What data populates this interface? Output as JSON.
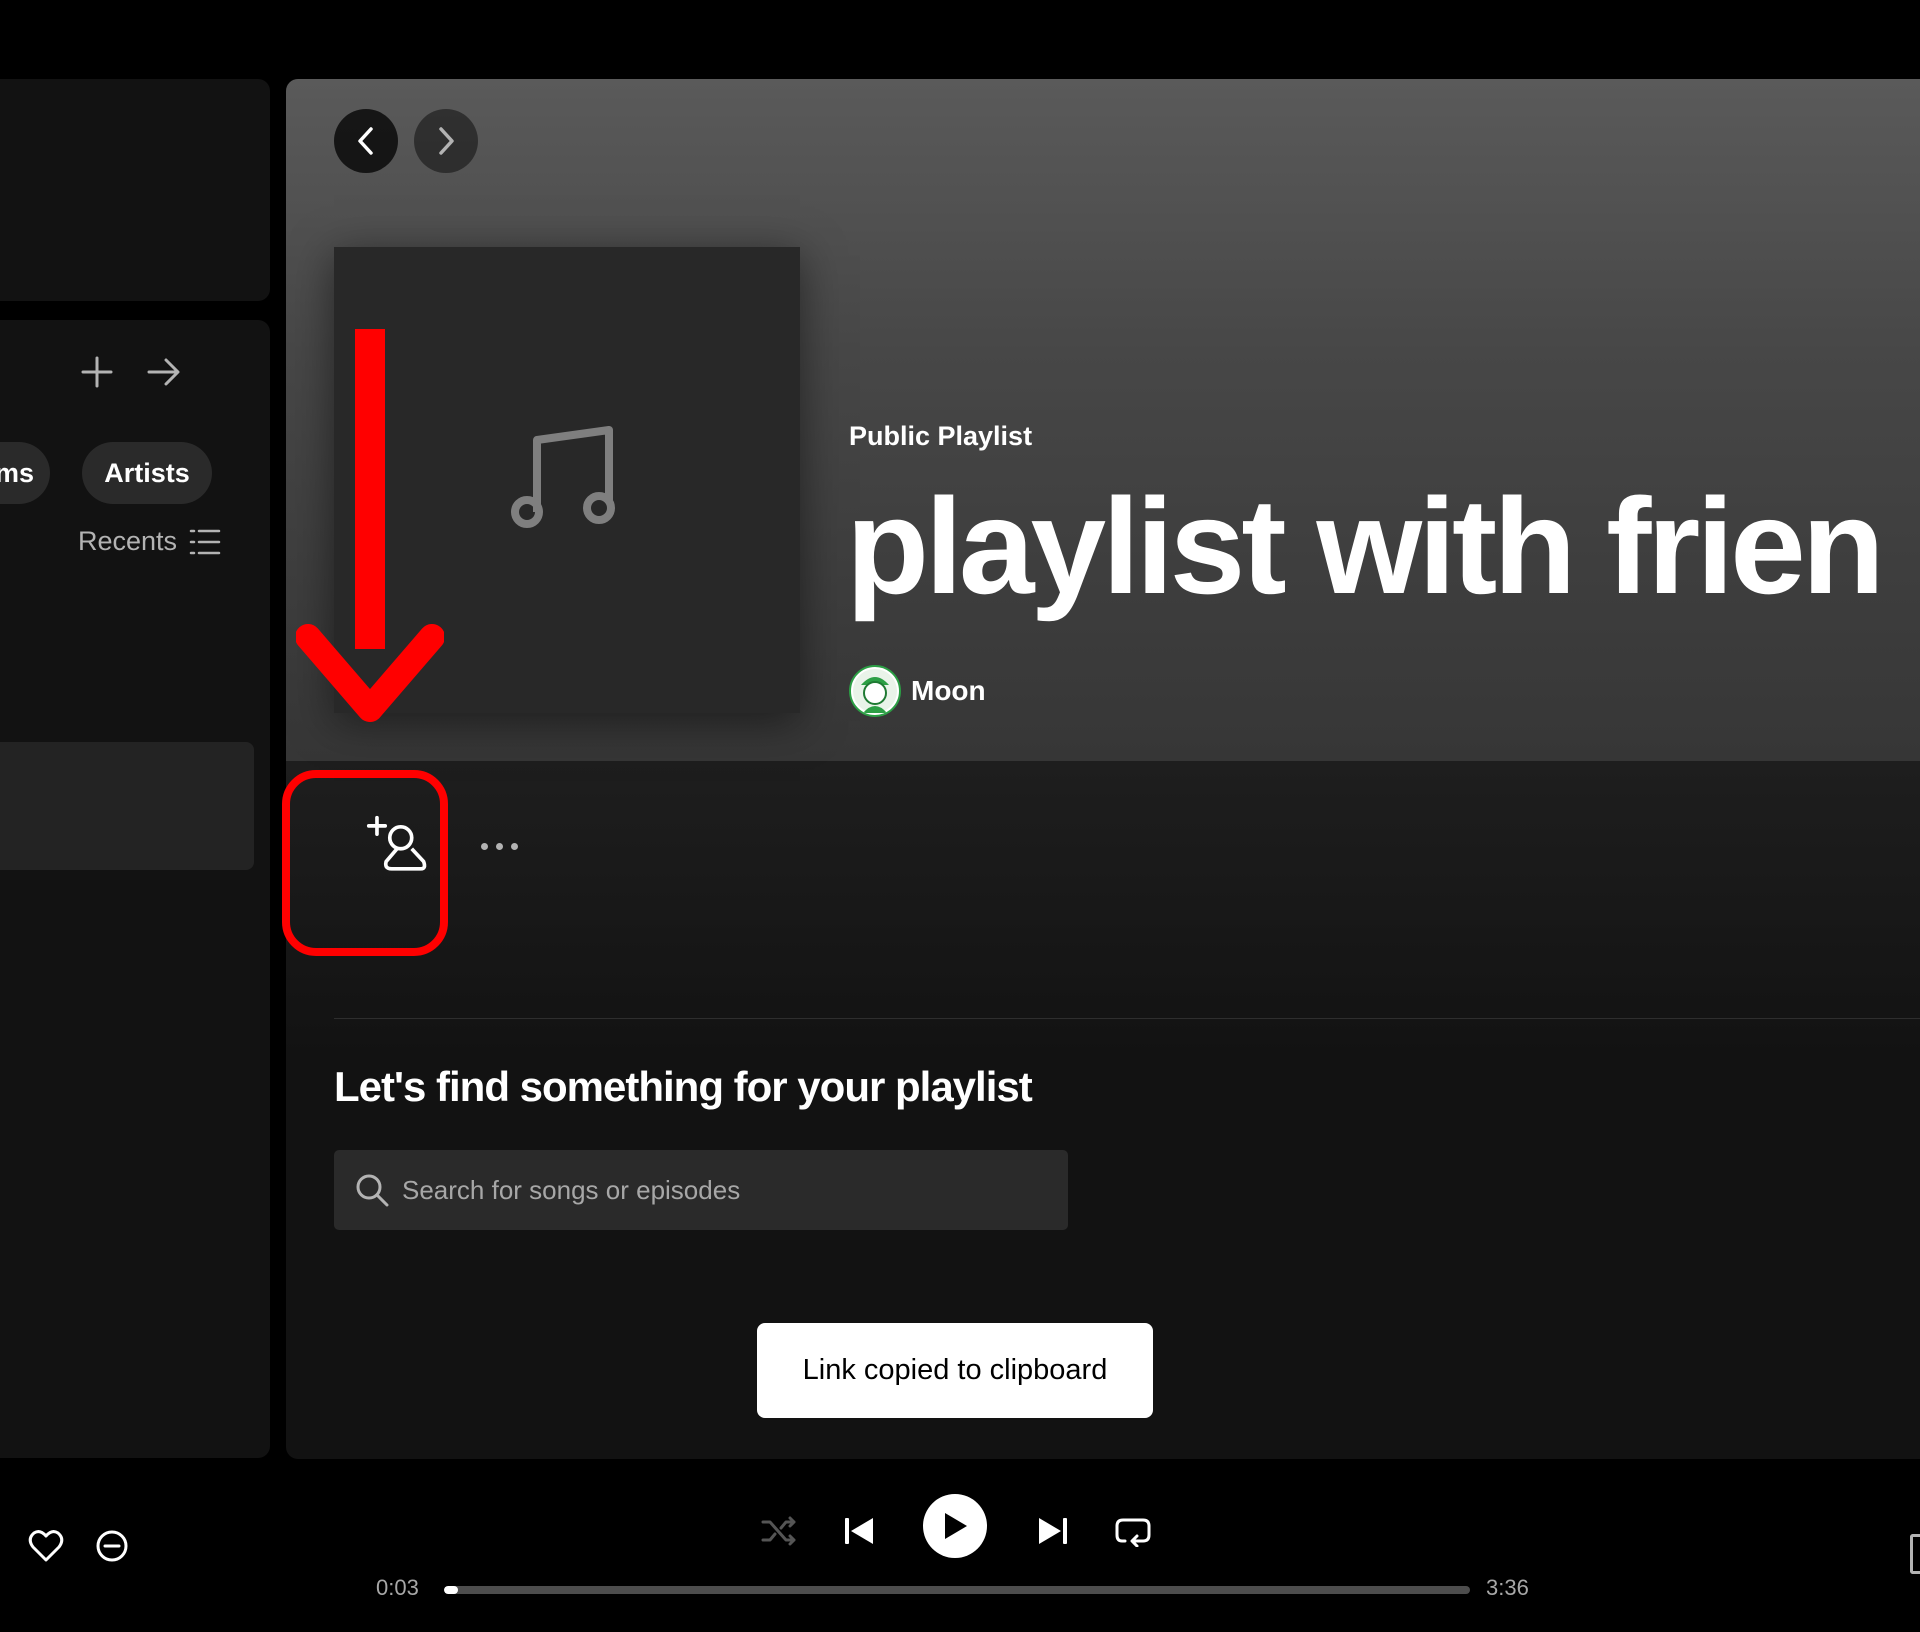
{
  "sidebar": {
    "filters": [
      "ums",
      "Artists"
    ],
    "sort_label": "Recents"
  },
  "playlist": {
    "type_label": "Public Playlist",
    "title": "playlist with frien",
    "owner": "Moon"
  },
  "find_section": {
    "title": "Let's find something for your playlist",
    "search_placeholder": "Search for songs or episodes"
  },
  "toast": {
    "message": "Link copied to clipboard"
  },
  "player": {
    "elapsed": "0:03",
    "duration": "3:36",
    "progress_fraction": 0.014
  },
  "colors": {
    "annotation": "#ff0000",
    "background": "#121212",
    "accent": "#ffffff"
  },
  "icons": [
    "chevron-left-icon",
    "chevron-right-icon",
    "music-note-icon",
    "add-user-icon",
    "more-icon",
    "plus-icon",
    "arrow-right-icon",
    "list-icon",
    "search-icon",
    "heart-icon",
    "minus-circle-icon",
    "shuffle-icon",
    "skip-back-icon",
    "play-icon",
    "skip-forward-icon",
    "repeat-icon"
  ]
}
